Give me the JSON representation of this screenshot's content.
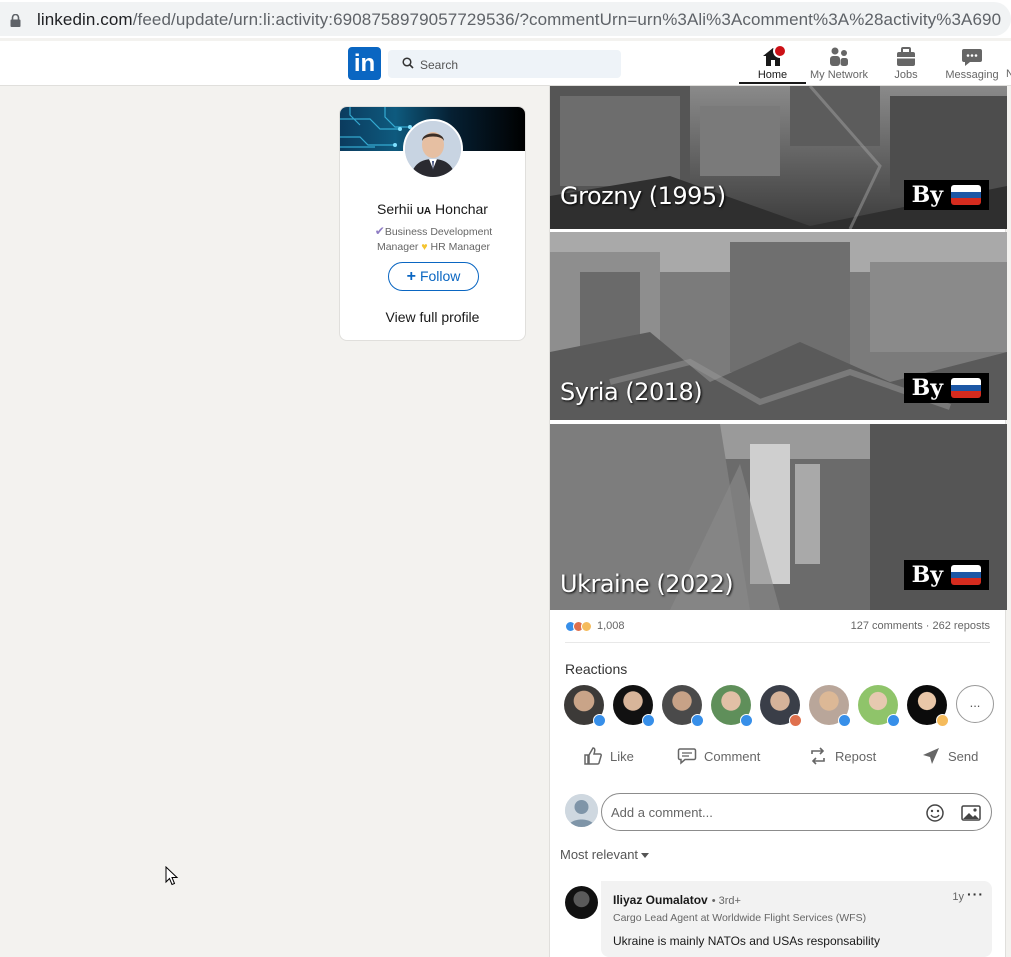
{
  "browser": {
    "url_host": "linkedin.com",
    "url_rest": "/feed/update/urn:li:activity:6908758979057729536/?commentUrn=urn%3Ali%3Acomment%3A%28activity%3A690"
  },
  "nav": {
    "logo": "in",
    "search_placeholder": "Search",
    "items": [
      {
        "label": "Home",
        "icon": "home-icon",
        "active": true
      },
      {
        "label": "My Network",
        "icon": "network-icon"
      },
      {
        "label": "Jobs",
        "icon": "briefcase-icon"
      },
      {
        "label": "Messaging",
        "icon": "messaging-icon"
      }
    ],
    "overflow_letter": "N"
  },
  "profile": {
    "first_name": "Serhii",
    "country_tag": "UA",
    "last_name": "Honchar",
    "headline_1": "Business Development",
    "headline_2": "Manager",
    "headline_3": "HR Manager",
    "follow_label": "Follow",
    "view_profile": "View full profile"
  },
  "post": {
    "panels": [
      {
        "caption": "Grozny (1995)",
        "by": "By"
      },
      {
        "caption": "Syria (2018)",
        "by": "By"
      },
      {
        "caption": "Ukraine (2022)",
        "by": "By"
      }
    ],
    "reaction_count": "1,008",
    "comments_reposts": "127 comments · 262 reposts",
    "reactions_title": "Reactions",
    "more_reactors": "...",
    "actions": [
      {
        "label": "Like",
        "icon": "like-icon"
      },
      {
        "label": "Comment",
        "icon": "comment-icon"
      },
      {
        "label": "Repost",
        "icon": "repost-icon"
      },
      {
        "label": "Send",
        "icon": "send-icon"
      }
    ],
    "comment_placeholder": "Add a comment...",
    "sort_label": "Most relevant"
  },
  "comment": {
    "author": "Iliyaz Oumalatov",
    "degree": "• 3rd+",
    "time": "1y",
    "more": "···",
    "title": "Cargo Lead Agent at Worldwide Flight Services (WFS)",
    "text": "Ukraine is mainly NATOs and USAs responsability"
  },
  "colors": {
    "brand": "#0a66c2",
    "badge": "#cc1016",
    "background": "#f3f2ef"
  }
}
